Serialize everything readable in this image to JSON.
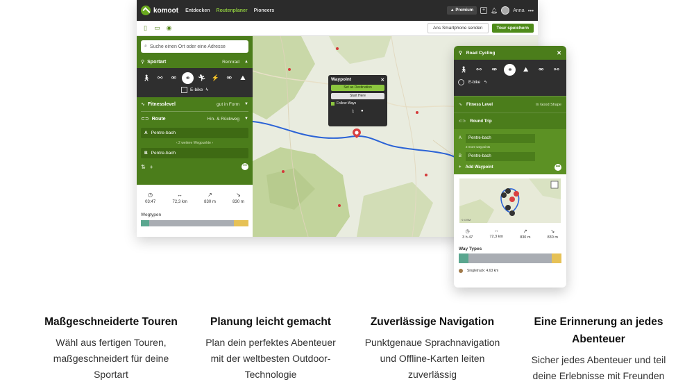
{
  "desktop": {
    "brand": "komoot",
    "nav": [
      "Entdecken",
      "Routenplaner",
      "Pioneers"
    ],
    "premium_label": "Premium",
    "user_name": "Anna",
    "toolbar": {
      "smartphone_button": "Ans Smartphone senden",
      "save_button": "Tour speichern"
    },
    "sidebar": {
      "search_placeholder": "Suche einen Ort oder eine Adresse",
      "sport_label": "Sportart",
      "sport_value": "Rennrad",
      "ebike_label": "E-bike",
      "fitness_label": "Fitnesslevel",
      "fitness_value": "gut in Form",
      "route_label": "Route",
      "route_value": "Hin- & Rückweg",
      "waypoint_a_letter": "A",
      "waypoint_a": "Pentre-bach",
      "more_waypoints": "2 weitere Wegpunkte",
      "waypoint_b_letter": "B",
      "waypoint_b": "Pentre-bach",
      "stats": {
        "duration": "03:47",
        "distance": "72,3 km",
        "ascent": "830 m",
        "descent": "830 m"
      },
      "waytypes_label": "Wegtypen",
      "waytypes_colors": [
        "#5aa68f",
        "#a9adb3",
        "#e6c156"
      ]
    },
    "waypoint_popup": {
      "title": "Waypoint",
      "destination": "Set as Destination",
      "start": "Start Here",
      "follow": "Follow Ways"
    }
  },
  "phone": {
    "header": "Road Cycling",
    "ebike_label": "E-bike",
    "fitness_label": "Fitness Level",
    "fitness_value": "In Good Shape",
    "round_trip": "Round Trip",
    "wp_a_letter": "A",
    "wp_a": "Pentre-bach",
    "more_waypoints": "2 more waypoints",
    "wp_b_letter": "B",
    "wp_b": "Pentre-bach",
    "add_waypoint": "Add Waypoint",
    "stats": {
      "duration": "3 h 47",
      "distance": "72,3 km",
      "ascent": "830 m",
      "descent": "830 m"
    },
    "waytypes_label": "Way Types",
    "singletrack": "Singletrack: 4,63 km",
    "map_credit": "© OSM"
  },
  "features": [
    {
      "title": "Maßgeschneiderte Touren",
      "text": [
        "Wähl aus fertigen Touren,",
        "maßgeschneidert für deine",
        "Sportart"
      ]
    },
    {
      "title": "Planung leicht gemacht",
      "text": [
        "Plan dein perfektes Abenteuer",
        "mit der weltbesten Outdoor-",
        "Technologie"
      ]
    },
    {
      "title": "Zuverlässige Navigation",
      "text": [
        "Punktgenaue Sprachnavigation",
        "und Offline-Karten leiten",
        "zuverlässig"
      ]
    },
    {
      "title_lines": [
        "Eine Erinnerung an jedes",
        "Abenteuer"
      ],
      "text": [
        "Sicher jedes Abenteuer und teil",
        "deine Erlebnisse mit Freunden"
      ]
    }
  ]
}
